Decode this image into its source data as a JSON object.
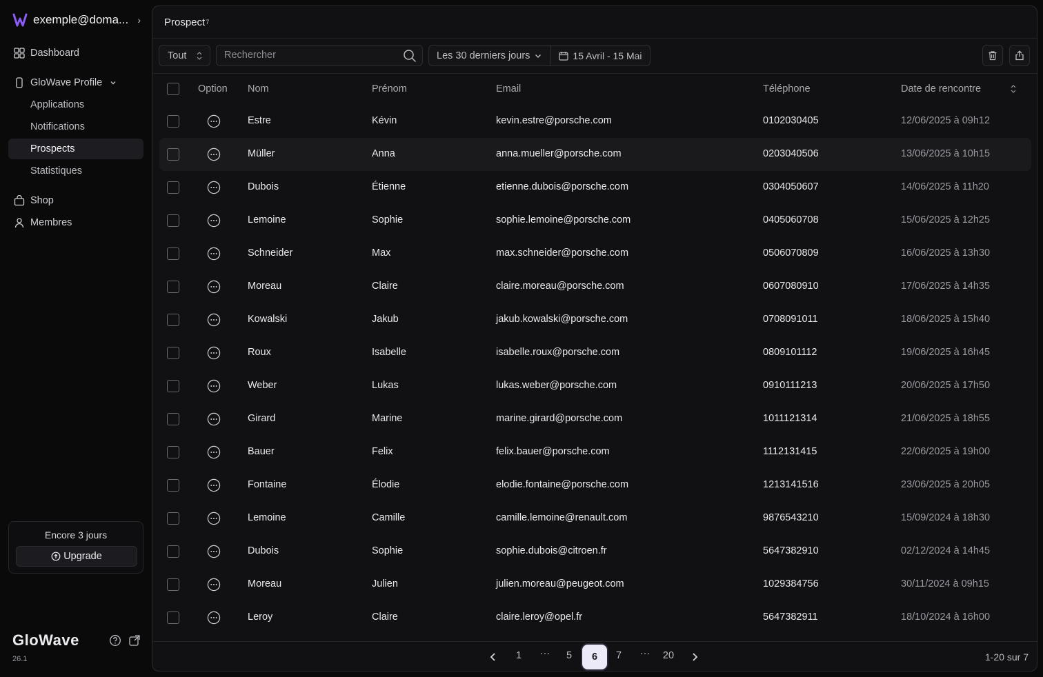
{
  "account": {
    "email": "exemple@doma..."
  },
  "nav": {
    "dashboard": "Dashboard",
    "profile": "GloWave Profile",
    "sub": [
      "Applications",
      "Notifications",
      "Prospects",
      "Statistiques"
    ],
    "shop": "Shop",
    "members": "Membres"
  },
  "trial": {
    "days_left": "Encore 3 jours",
    "upgrade": "Upgrade"
  },
  "brand": {
    "name": "GloWave",
    "version": "26.1"
  },
  "page": {
    "title": "Prospect",
    "title_sup": "7"
  },
  "toolbar": {
    "filter_value": "Tout",
    "search_placeholder": "Rechercher",
    "period": "Les 30 derniers jours",
    "dates": "15 Avril - 15 Mai"
  },
  "table": {
    "headers": [
      "Option",
      "Nom",
      "Prénom",
      "Email",
      "Téléphone",
      "Date de rencontre"
    ],
    "rows": [
      [
        "Estre",
        "Kévin",
        "kevin.estre@porsche.com",
        "0102030405",
        "12/06/2025 à 09h12"
      ],
      [
        "Müller",
        "Anna",
        "anna.mueller@porsche.com",
        "0203040506",
        "13/06/2025 à 10h15"
      ],
      [
        "Dubois",
        "Étienne",
        "etienne.dubois@porsche.com",
        "0304050607",
        "14/06/2025 à 11h20"
      ],
      [
        "Lemoine",
        "Sophie",
        "sophie.lemoine@porsche.com",
        "0405060708",
        "15/06/2025 à 12h25"
      ],
      [
        "Schneider",
        "Max",
        "max.schneider@porsche.com",
        "0506070809",
        "16/06/2025 à 13h30"
      ],
      [
        "Moreau",
        "Claire",
        "claire.moreau@porsche.com",
        "0607080910",
        "17/06/2025 à 14h35"
      ],
      [
        "Kowalski",
        "Jakub",
        "jakub.kowalski@porsche.com",
        "0708091011",
        "18/06/2025 à 15h40"
      ],
      [
        "Roux",
        "Isabelle",
        "isabelle.roux@porsche.com",
        "0809101112",
        "19/06/2025 à 16h45"
      ],
      [
        "Weber",
        "Lukas",
        "lukas.weber@porsche.com",
        "0910111213",
        "20/06/2025 à 17h50"
      ],
      [
        "Girard",
        "Marine",
        "marine.girard@porsche.com",
        "1011121314",
        "21/06/2025 à 18h55"
      ],
      [
        "Bauer",
        "Felix",
        "felix.bauer@porsche.com",
        "1112131415",
        "22/06/2025 à 19h00"
      ],
      [
        "Fontaine",
        "Élodie",
        "elodie.fontaine@porsche.com",
        "1213141516",
        "23/06/2025 à 20h05"
      ],
      [
        "Lemoine",
        "Camille",
        "camille.lemoine@renault.com",
        "9876543210",
        "15/09/2024 à 18h30"
      ],
      [
        "Dubois",
        "Sophie",
        "sophie.dubois@citroen.fr",
        "5647382910",
        "02/12/2024 à 14h45"
      ],
      [
        "Moreau",
        "Julien",
        "julien.moreau@peugeot.com",
        "1029384756",
        "30/11/2024 à 09h15"
      ],
      [
        "Leroy",
        "Claire",
        "claire.leroy@opel.fr",
        "5647382911",
        "18/10/2024 à 16h00"
      ]
    ]
  },
  "pagination": {
    "pages": [
      "1",
      "···",
      "5",
      "6",
      "7",
      "···",
      "20"
    ],
    "current": "6",
    "summary": "1-20 sur 7"
  }
}
